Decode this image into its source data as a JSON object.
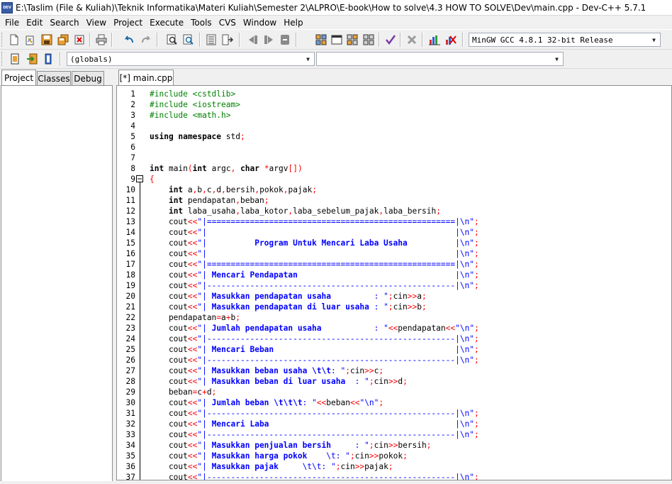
{
  "window": {
    "app_icon_text": "DEV",
    "title": "E:\\Taslim (File & Kuliah)\\Teknik Informatika\\Materi Kuliah\\Semester 2\\ALPRO\\E-book\\How to solve\\4.3 HOW TO SOLVE\\Dev\\main.cpp - Dev-C++ 5.7.1"
  },
  "menu": [
    "File",
    "Edit",
    "Search",
    "View",
    "Project",
    "Execute",
    "Tools",
    "CVS",
    "Window",
    "Help"
  ],
  "toolbar": {
    "compiler_select": "MinGW GCC 4.8.1 32-bit Release",
    "scope_select": "(globals)",
    "function_select": ""
  },
  "left_tabs": [
    "Project",
    "Classes",
    "Debug"
  ],
  "editor_tab": "[*] main.cpp",
  "code_lines": [
    [
      [
        "pp",
        "#include <cstdlib>"
      ]
    ],
    [
      [
        "pp",
        "#include <iostream>"
      ]
    ],
    [
      [
        "pp",
        "#include <math.h>"
      ]
    ],
    [],
    [
      [
        "kw",
        "using namespace"
      ],
      [
        "tx",
        " std"
      ],
      [
        "sym",
        ";"
      ]
    ],
    [],
    [],
    [
      [
        "kw",
        "int"
      ],
      [
        "tx",
        " main"
      ],
      [
        "sym",
        "("
      ],
      [
        "kw",
        "int"
      ],
      [
        "tx",
        " argc"
      ],
      [
        "sym",
        ","
      ],
      [
        "tx",
        " "
      ],
      [
        "kw",
        "char"
      ],
      [
        "tx",
        " "
      ],
      [
        "sym",
        "*"
      ],
      [
        "tx",
        "argv"
      ],
      [
        "sym",
        "[])"
      ]
    ],
    [
      [
        "sym",
        "{"
      ]
    ],
    [
      [
        "tx",
        "    "
      ],
      [
        "kw",
        "int"
      ],
      [
        "tx",
        " a"
      ],
      [
        "sym",
        ","
      ],
      [
        "tx",
        "b"
      ],
      [
        "sym",
        ","
      ],
      [
        "tx",
        "c"
      ],
      [
        "sym",
        ","
      ],
      [
        "tx",
        "d"
      ],
      [
        "sym",
        ","
      ],
      [
        "tx",
        "bersih"
      ],
      [
        "sym",
        ","
      ],
      [
        "tx",
        "pokok"
      ],
      [
        "sym",
        ","
      ],
      [
        "tx",
        "pajak"
      ],
      [
        "sym",
        ";"
      ]
    ],
    [
      [
        "tx",
        "    "
      ],
      [
        "kw",
        "int"
      ],
      [
        "tx",
        " pendapatan"
      ],
      [
        "sym",
        ","
      ],
      [
        "tx",
        "beban"
      ],
      [
        "sym",
        ";"
      ]
    ],
    [
      [
        "tx",
        "    "
      ],
      [
        "kw",
        "int"
      ],
      [
        "tx",
        " laba_usaha"
      ],
      [
        "sym",
        ","
      ],
      [
        "tx",
        "laba_kotor"
      ],
      [
        "sym",
        ","
      ],
      [
        "tx",
        "laba_sebelum_pajak"
      ],
      [
        "sym",
        ","
      ],
      [
        "tx",
        "laba_bersih"
      ],
      [
        "sym",
        ";"
      ]
    ],
    [
      [
        "tx",
        "    cout"
      ],
      [
        "sym",
        "<<"
      ],
      [
        "st",
        "\"|====================================================|\\n\""
      ],
      [
        "sym",
        ";"
      ]
    ],
    [
      [
        "tx",
        "    cout"
      ],
      [
        "sym",
        "<<"
      ],
      [
        "st",
        "\"|                                                    |\\n\""
      ],
      [
        "sym",
        ";"
      ]
    ],
    [
      [
        "tx",
        "    cout"
      ],
      [
        "sym",
        "<<"
      ],
      [
        "st",
        "\"|          "
      ],
      [
        "sb",
        "Program Untuk Mencari Laba Usaha"
      ],
      [
        "st",
        "          |\\n\""
      ],
      [
        "sym",
        ";"
      ]
    ],
    [
      [
        "tx",
        "    cout"
      ],
      [
        "sym",
        "<<"
      ],
      [
        "st",
        "\"|                                                    |\\n\""
      ],
      [
        "sym",
        ";"
      ]
    ],
    [
      [
        "tx",
        "    cout"
      ],
      [
        "sym",
        "<<"
      ],
      [
        "st",
        "\"|====================================================|\\n\""
      ],
      [
        "sym",
        ";"
      ]
    ],
    [
      [
        "tx",
        "    cout"
      ],
      [
        "sym",
        "<<"
      ],
      [
        "st",
        "\"| "
      ],
      [
        "sb",
        "Mencari Pendapatan"
      ],
      [
        "st",
        "                                 |\\n\""
      ],
      [
        "sym",
        ";"
      ]
    ],
    [
      [
        "tx",
        "    cout"
      ],
      [
        "sym",
        "<<"
      ],
      [
        "st",
        "\"|----------------------------------------------------|\\n\""
      ],
      [
        "sym",
        ";"
      ]
    ],
    [
      [
        "tx",
        "    cout"
      ],
      [
        "sym",
        "<<"
      ],
      [
        "st",
        "\"| "
      ],
      [
        "sb",
        "Masukkan pendapatan usaha"
      ],
      [
        "st",
        "         : \""
      ],
      [
        "sym",
        ";"
      ],
      [
        "tx",
        "cin"
      ],
      [
        "sym",
        ">>"
      ],
      [
        "tx",
        "a"
      ],
      [
        "sym",
        ";"
      ]
    ],
    [
      [
        "tx",
        "    cout"
      ],
      [
        "sym",
        "<<"
      ],
      [
        "st",
        "\"| "
      ],
      [
        "sb",
        "Masukkan pendapatan di luar usaha"
      ],
      [
        "st",
        " : \""
      ],
      [
        "sym",
        ";"
      ],
      [
        "tx",
        "cin"
      ],
      [
        "sym",
        ">>"
      ],
      [
        "tx",
        "b"
      ],
      [
        "sym",
        ";"
      ]
    ],
    [
      [
        "tx",
        "    pendapatan"
      ],
      [
        "sym",
        "="
      ],
      [
        "tx",
        "a"
      ],
      [
        "sym",
        "+"
      ],
      [
        "tx",
        "b"
      ],
      [
        "sym",
        ";"
      ]
    ],
    [
      [
        "tx",
        "    cout"
      ],
      [
        "sym",
        "<<"
      ],
      [
        "st",
        "\"| "
      ],
      [
        "sb",
        "Jumlah pendapatan usaha"
      ],
      [
        "st",
        "           : \""
      ],
      [
        "sym",
        "<<"
      ],
      [
        "tx",
        "pendapatan"
      ],
      [
        "sym",
        "<<"
      ],
      [
        "st",
        "\"\\n\""
      ],
      [
        "sym",
        ";"
      ]
    ],
    [
      [
        "tx",
        "    cout"
      ],
      [
        "sym",
        "<<"
      ],
      [
        "st",
        "\"|----------------------------------------------------|\\n\""
      ],
      [
        "sym",
        ";"
      ]
    ],
    [
      [
        "tx",
        "    cout"
      ],
      [
        "sym",
        "<<"
      ],
      [
        "st",
        "\"| "
      ],
      [
        "sb",
        "Mencari Beban"
      ],
      [
        "st",
        "                                      |\\n\""
      ],
      [
        "sym",
        ";"
      ]
    ],
    [
      [
        "tx",
        "    cout"
      ],
      [
        "sym",
        "<<"
      ],
      [
        "st",
        "\"|----------------------------------------------------|\\n\""
      ],
      [
        "sym",
        ";"
      ]
    ],
    [
      [
        "tx",
        "    cout"
      ],
      [
        "sym",
        "<<"
      ],
      [
        "st",
        "\"| "
      ],
      [
        "sb",
        "Masukkan beban usaha \\t\\t"
      ],
      [
        "st",
        ": \""
      ],
      [
        "sym",
        ";"
      ],
      [
        "tx",
        "cin"
      ],
      [
        "sym",
        ">>"
      ],
      [
        "tx",
        "c"
      ],
      [
        "sym",
        ";"
      ]
    ],
    [
      [
        "tx",
        "    cout"
      ],
      [
        "sym",
        "<<"
      ],
      [
        "st",
        "\"| "
      ],
      [
        "sb",
        "Masukkan beban di luar usaha"
      ],
      [
        "st",
        "  : \""
      ],
      [
        "sym",
        ";"
      ],
      [
        "tx",
        "cin"
      ],
      [
        "sym",
        ">>"
      ],
      [
        "tx",
        "d"
      ],
      [
        "sym",
        ";"
      ]
    ],
    [
      [
        "tx",
        "    beban"
      ],
      [
        "sym",
        "="
      ],
      [
        "tx",
        "c"
      ],
      [
        "sym",
        "+"
      ],
      [
        "tx",
        "d"
      ],
      [
        "sym",
        ";"
      ]
    ],
    [
      [
        "tx",
        "    cout"
      ],
      [
        "sym",
        "<<"
      ],
      [
        "st",
        "\"| "
      ],
      [
        "sb",
        "Jumlah beban \\t\\t\\t"
      ],
      [
        "st",
        ": \""
      ],
      [
        "sym",
        "<<"
      ],
      [
        "tx",
        "beban"
      ],
      [
        "sym",
        "<<"
      ],
      [
        "st",
        "\"\\n\""
      ],
      [
        "sym",
        ";"
      ]
    ],
    [
      [
        "tx",
        "    cout"
      ],
      [
        "sym",
        "<<"
      ],
      [
        "st",
        "\"|----------------------------------------------------|\\n\""
      ],
      [
        "sym",
        ";"
      ]
    ],
    [
      [
        "tx",
        "    cout"
      ],
      [
        "sym",
        "<<"
      ],
      [
        "st",
        "\"| "
      ],
      [
        "sb",
        "Mencari Laba"
      ],
      [
        "st",
        "                                       |\\n\""
      ],
      [
        "sym",
        ";"
      ]
    ],
    [
      [
        "tx",
        "    cout"
      ],
      [
        "sym",
        "<<"
      ],
      [
        "st",
        "\"|----------------------------------------------------|\\n\""
      ],
      [
        "sym",
        ";"
      ]
    ],
    [
      [
        "tx",
        "    cout"
      ],
      [
        "sym",
        "<<"
      ],
      [
        "st",
        "\"| "
      ],
      [
        "sb",
        "Masukkan penjualan bersih"
      ],
      [
        "st",
        "     : \""
      ],
      [
        "sym",
        ";"
      ],
      [
        "tx",
        "cin"
      ],
      [
        "sym",
        ">>"
      ],
      [
        "tx",
        "bersih"
      ],
      [
        "sym",
        ";"
      ]
    ],
    [
      [
        "tx",
        "    cout"
      ],
      [
        "sym",
        "<<"
      ],
      [
        "st",
        "\"| "
      ],
      [
        "sb",
        "Masukkan harga pokok"
      ],
      [
        "st",
        "    \\t: \""
      ],
      [
        "sym",
        ";"
      ],
      [
        "tx",
        "cin"
      ],
      [
        "sym",
        ">>"
      ],
      [
        "tx",
        "pokok"
      ],
      [
        "sym",
        ";"
      ]
    ],
    [
      [
        "tx",
        "    cout"
      ],
      [
        "sym",
        "<<"
      ],
      [
        "st",
        "\"| "
      ],
      [
        "sb",
        "Masukkan pajak"
      ],
      [
        "st",
        "     \\t\\t: \""
      ],
      [
        "sym",
        ";"
      ],
      [
        "tx",
        "cin"
      ],
      [
        "sym",
        ">>"
      ],
      [
        "tx",
        "pajak"
      ],
      [
        "sym",
        ";"
      ]
    ],
    [
      [
        "tx",
        "    cout"
      ],
      [
        "sym",
        "<<"
      ],
      [
        "st",
        "\"|----------------------------------------------------|\\n\""
      ],
      [
        "sym",
        ";"
      ]
    ]
  ]
}
